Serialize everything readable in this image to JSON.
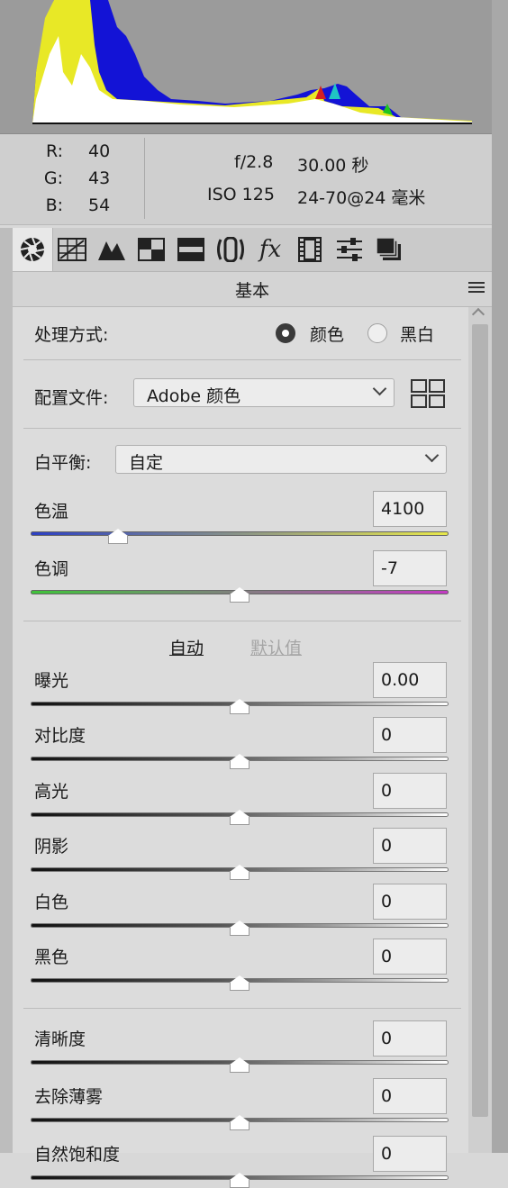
{
  "info": {
    "r_label": "R:",
    "r_value": "40",
    "g_label": "G:",
    "g_value": "43",
    "b_label": "B:",
    "b_value": "54",
    "aperture": "f/2.8",
    "shutter": "30.00 秒",
    "iso": "ISO 125",
    "lens": "24-70@24 毫米"
  },
  "toolbar": {
    "icons": [
      "aperture-icon",
      "grid-icon",
      "mountains-icon",
      "split-toning-icon",
      "split-rows-icon",
      "lens-icon",
      "fx-icon",
      "film-icon",
      "sliders-icon",
      "stack-icon"
    ]
  },
  "panel": {
    "title": "基本"
  },
  "treatment": {
    "label": "处理方式:",
    "color": "颜色",
    "bw": "黑白",
    "selected": "颜色"
  },
  "profile": {
    "label": "配置文件:",
    "value": "Adobe 颜色"
  },
  "white_balance": {
    "label": "白平衡:",
    "value": "自定"
  },
  "temp": {
    "label": "色温",
    "value": "4100",
    "position": 0.21
  },
  "tint": {
    "label": "色调",
    "value": "-7",
    "position": 0.5
  },
  "auto_label": "自动",
  "default_label": "默认值",
  "tone": [
    {
      "label": "曝光",
      "value": "0.00"
    },
    {
      "label": "对比度",
      "value": "0"
    },
    {
      "label": "高光",
      "value": "0"
    },
    {
      "label": "阴影",
      "value": "0"
    },
    {
      "label": "白色",
      "value": "0"
    },
    {
      "label": "黑色",
      "value": "0"
    }
  ],
  "presence": [
    {
      "label": "清晰度",
      "value": "0"
    },
    {
      "label": "去除薄雾",
      "value": "0"
    },
    {
      "label": "自然饱和度",
      "value": "0"
    }
  ],
  "colors": {
    "temp_gradient": [
      "#2b3fc4",
      "#e8e84a"
    ],
    "tint_gradient": [
      "#3fc43a",
      "#c43ac4"
    ]
  }
}
